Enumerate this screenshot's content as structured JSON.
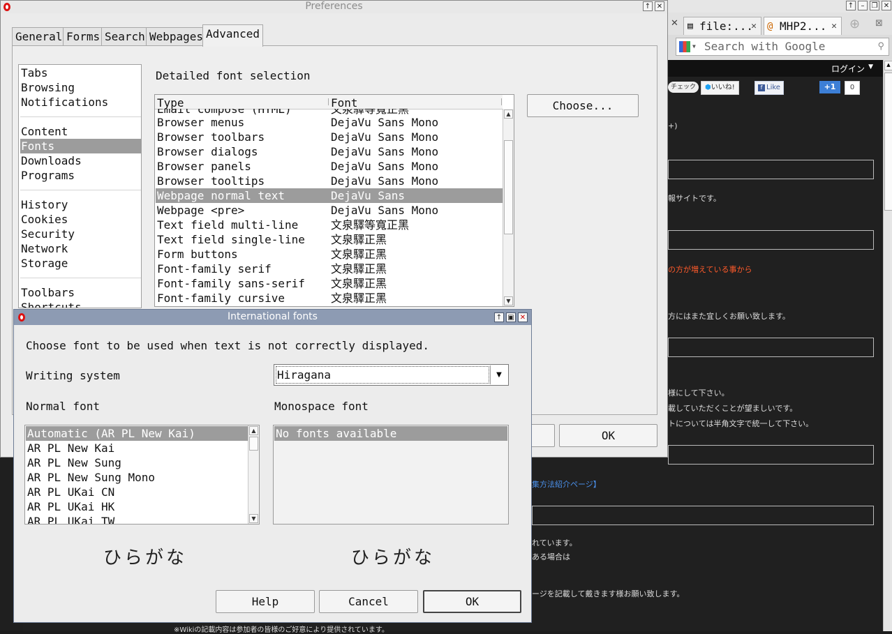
{
  "browser": {
    "tabs": [
      {
        "label": "file:..."
      },
      {
        "label": "MHP2..."
      }
    ],
    "search_placeholder": "Search with Google",
    "login_label": "ログイン",
    "social": {
      "check": "チェック",
      "iine": "いいね!",
      "like": "Like",
      "plus_one": "+1",
      "plus_count": "0"
    },
    "page_snippets": [
      "+)",
      "報サイトです。",
      "の方が増えている事から",
      "方にはまた宜しくお願い致します。",
      "様にして下さい。",
      "載していただくことが望ましいです。",
      "トについては半角文字で統一して下さい。",
      "集方法紹介ページ】",
      "れています。",
      "ある場合は",
      "ージを記載して戴きます様お願い致します。",
      "※Wikiの記載内容は参加者の皆様のご好意により提供されています。"
    ]
  },
  "prefs": {
    "title": "Preferences",
    "tabs": [
      "General",
      "Forms",
      "Search",
      "Webpages",
      "Advanced"
    ],
    "active_tab": "Advanced",
    "categories_group1": [
      "Tabs",
      "Browsing",
      "Notifications"
    ],
    "categories_group2": [
      "Content",
      "Fonts",
      "Downloads",
      "Programs"
    ],
    "categories_group3": [
      "History",
      "Cookies",
      "Security",
      "Network",
      "Storage"
    ],
    "categories_group4": [
      "Toolbars",
      "Shortcuts"
    ],
    "selected_category": "Fonts",
    "section_heading": "Detailed font selection",
    "table_headers": {
      "type": "Type",
      "font": "Font"
    },
    "font_rows": [
      {
        "type": "Email compose (HTML)",
        "font": "文泉驛等寬正黑"
      },
      {
        "type": "Browser menus",
        "font": "DejaVu Sans Mono"
      },
      {
        "type": "Browser toolbars",
        "font": "DejaVu Sans Mono"
      },
      {
        "type": "Browser dialogs",
        "font": "DejaVu Sans Mono"
      },
      {
        "type": "Browser panels",
        "font": "DejaVu Sans Mono"
      },
      {
        "type": "Browser tooltips",
        "font": "DejaVu Sans Mono"
      },
      {
        "type": "Webpage normal text",
        "font": "DejaVu Sans"
      },
      {
        "type": "Webpage <pre>",
        "font": "DejaVu Sans Mono"
      },
      {
        "type": "Text field multi-line",
        "font": "文泉驛等寬正黑"
      },
      {
        "type": "Text field single-line",
        "font": "文泉驛正黑"
      },
      {
        "type": "Form buttons",
        "font": "文泉驛正黑"
      },
      {
        "type": "Font-family serif",
        "font": "文泉驛正黑"
      },
      {
        "type": "Font-family sans-serif",
        "font": "文泉驛正黑"
      },
      {
        "type": "Font-family cursive",
        "font": "文泉驛正黑"
      }
    ],
    "selected_row": "Webpage normal text",
    "choose_button": "Choose...",
    "ok_button": "OK"
  },
  "intl": {
    "title": "International fonts",
    "instruction": "Choose font to be used when text is not correctly displayed.",
    "writing_system_label": "Writing system",
    "writing_system_value": "Hiragana",
    "normal_font_label": "Normal font",
    "monospace_font_label": "Monospace font",
    "normal_fonts": [
      "Automatic (AR PL New Kai)",
      "AR PL New Kai",
      "AR PL New Sung",
      "AR PL New Sung Mono",
      "AR PL UKai CN",
      "AR PL UKai HK",
      "AR PL UKai TW"
    ],
    "monospace_fonts": [
      "No fonts available"
    ],
    "preview_normal": "ひらがな",
    "preview_mono": "ひらがな",
    "help_button": "Help",
    "cancel_button": "Cancel",
    "ok_button": "OK"
  }
}
